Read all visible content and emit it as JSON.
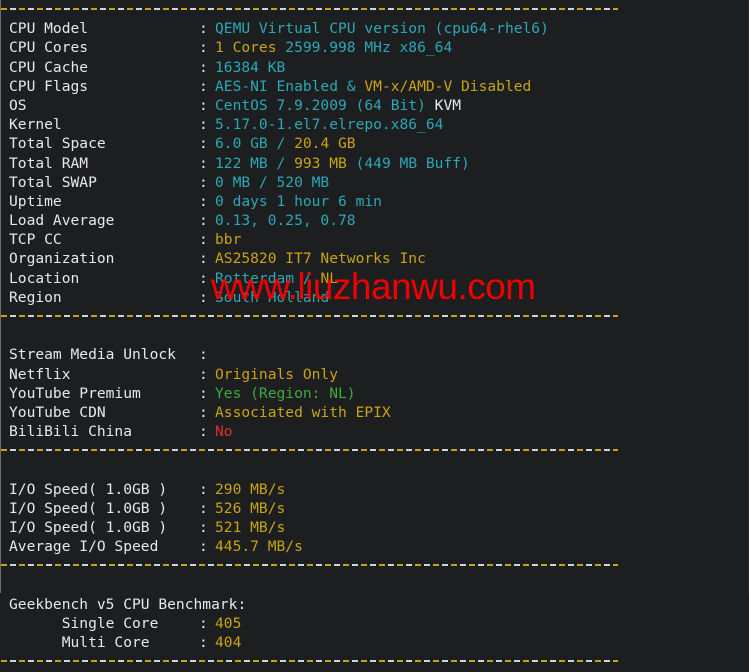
{
  "terminal": {
    "background": "#1d1e20",
    "foreground": "#e8e8e8",
    "watermark": "www.liuzhanwu.com",
    "watermark_color": "#ef0000"
  },
  "colors": {
    "cyan": "#2aa9b5",
    "yellow": "#c8a415",
    "green": "#3faa3f",
    "red": "#d83131",
    "white": "#e8e8e8"
  },
  "colon": ":",
  "sections": {
    "system": {
      "rows": [
        {
          "label": "CPU Model",
          "parts": [
            {
              "t": "QEMU Virtual CPU version (cpu64-rhel6)",
              "c": "cyan"
            }
          ]
        },
        {
          "label": "CPU Cores",
          "parts": [
            {
              "t": "1 Cores ",
              "c": "yellow"
            },
            {
              "t": "2599.998 MHz x86_64",
              "c": "cyan"
            }
          ]
        },
        {
          "label": "CPU Cache",
          "parts": [
            {
              "t": "16384 KB",
              "c": "cyan"
            }
          ]
        },
        {
          "label": "CPU Flags",
          "parts": [
            {
              "t": "AES-NI Enabled ",
              "c": "cyan"
            },
            {
              "t": "& ",
              "c": "cyan"
            },
            {
              "t": "VM-x/AMD-V Disabled",
              "c": "yellow"
            }
          ]
        },
        {
          "label": "OS",
          "parts": [
            {
              "t": "CentOS 7.9.2009 (64 Bit) ",
              "c": "cyan"
            },
            {
              "t": "KVM",
              "c": "white"
            }
          ]
        },
        {
          "label": "Kernel",
          "parts": [
            {
              "t": "5.17.0-1.el7.elrepo.x86_64",
              "c": "cyan"
            }
          ]
        },
        {
          "label": "Total Space",
          "parts": [
            {
              "t": "6.0 GB ",
              "c": "cyan"
            },
            {
              "t": "/ ",
              "c": "cyan"
            },
            {
              "t": "20.4 GB",
              "c": "yellow"
            }
          ]
        },
        {
          "label": "Total RAM",
          "parts": [
            {
              "t": "122 MB ",
              "c": "cyan"
            },
            {
              "t": "/ ",
              "c": "cyan"
            },
            {
              "t": "993 MB ",
              "c": "yellow"
            },
            {
              "t": "(449 MB Buff)",
              "c": "cyan"
            }
          ]
        },
        {
          "label": "Total SWAP",
          "parts": [
            {
              "t": "0 MB / 520 MB",
              "c": "cyan"
            }
          ]
        },
        {
          "label": "Uptime",
          "parts": [
            {
              "t": "0 days 1 hour 6 min",
              "c": "cyan"
            }
          ]
        },
        {
          "label": "Load Average",
          "parts": [
            {
              "t": "0.13, 0.25, 0.78",
              "c": "cyan"
            }
          ]
        },
        {
          "label": "TCP CC",
          "parts": [
            {
              "t": "bbr",
              "c": "yellow"
            }
          ]
        },
        {
          "label": "Organization",
          "parts": [
            {
              "t": "AS25820 IT7 Networks Inc",
              "c": "yellow"
            }
          ]
        },
        {
          "label": "Location",
          "parts": [
            {
              "t": "Rotterdam ",
              "c": "cyan"
            },
            {
              "t": "/ ",
              "c": "cyan"
            },
            {
              "t": "NL",
              "c": "yellow"
            }
          ]
        },
        {
          "label": "Region",
          "parts": [
            {
              "t": "South Holland",
              "c": "cyan"
            }
          ]
        }
      ]
    },
    "stream": {
      "rows": [
        {
          "label": "Stream Media Unlock",
          "parts": []
        },
        {
          "label": "Netflix",
          "parts": [
            {
              "t": "Originals Only",
              "c": "yellow"
            }
          ]
        },
        {
          "label": "YouTube Premium",
          "parts": [
            {
              "t": "Yes (Region: NL)",
              "c": "green"
            }
          ]
        },
        {
          "label": "YouTube CDN",
          "parts": [
            {
              "t": "Associated with EPIX",
              "c": "yellow"
            }
          ]
        },
        {
          "label": "BiliBili China",
          "parts": [
            {
              "t": "No",
              "c": "red"
            }
          ]
        }
      ]
    },
    "io": {
      "rows": [
        {
          "label": "I/O Speed( 1.0GB )",
          "parts": [
            {
              "t": "290 MB/s",
              "c": "yellow"
            }
          ]
        },
        {
          "label": "I/O Speed( 1.0GB )",
          "parts": [
            {
              "t": "526 MB/s",
              "c": "yellow"
            }
          ]
        },
        {
          "label": "I/O Speed( 1.0GB )",
          "parts": [
            {
              "t": "521 MB/s",
              "c": "yellow"
            }
          ]
        },
        {
          "label": "Average I/O Speed",
          "parts": [
            {
              "t": "445.7 MB/s",
              "c": "yellow"
            }
          ]
        }
      ]
    },
    "geekbench": {
      "heading": "Geekbench v5 CPU Benchmark:",
      "rows": [
        {
          "label": "      Single Core",
          "parts": [
            {
              "t": "405",
              "c": "yellow"
            }
          ]
        },
        {
          "label": "      Multi Core",
          "parts": [
            {
              "t": "404",
              "c": "yellow"
            }
          ]
        }
      ]
    }
  }
}
